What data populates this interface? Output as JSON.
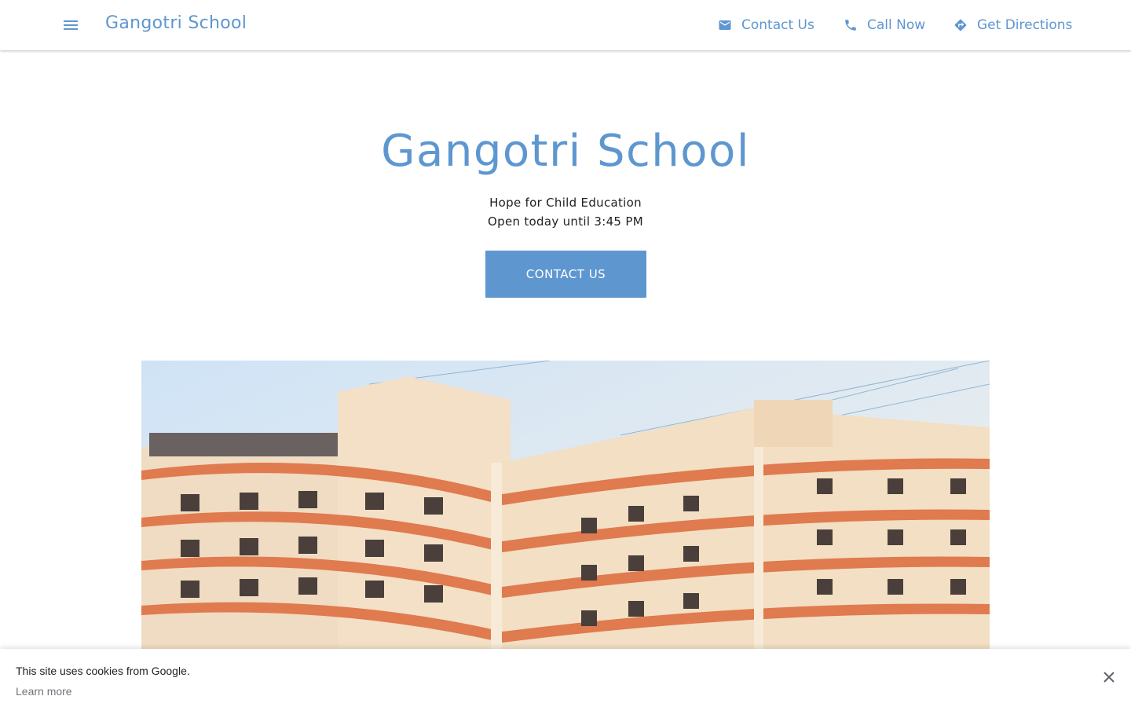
{
  "header": {
    "brand": "Gangotri School",
    "nav": [
      {
        "label": "Contact Us",
        "icon": "mail-icon"
      },
      {
        "label": "Call Now",
        "icon": "phone-icon"
      },
      {
        "label": "Get Directions",
        "icon": "directions-icon"
      }
    ]
  },
  "hero": {
    "title": "Gangotri School",
    "tagline": "Hope for Child Education",
    "hours": "Open today until 3:45 PM",
    "cta_label": "CONTACT US"
  },
  "cookie_banner": {
    "message": "This site uses cookies from Google.",
    "link": "Learn more"
  },
  "colors": {
    "accent": "#5e97cf",
    "text": "#212121",
    "muted": "#70757a"
  }
}
